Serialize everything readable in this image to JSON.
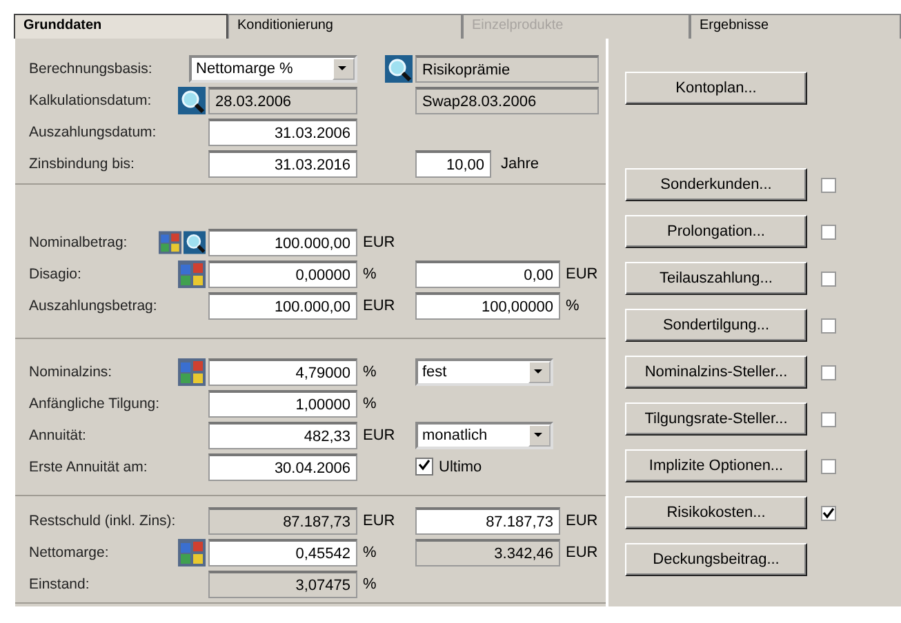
{
  "tabs": [
    {
      "label": "Grunddaten",
      "selected": true,
      "disabled": false
    },
    {
      "label": "Konditionierung",
      "selected": false,
      "disabled": false
    },
    {
      "label": "Einzelprodukte",
      "selected": false,
      "disabled": true
    },
    {
      "label": "Ergebnisse",
      "selected": false,
      "disabled": false
    }
  ],
  "sections": [
    {
      "rows": [
        {
          "label": "Berechnungsbasis:",
          "main": {
            "kind": "dropdown",
            "value": "Nettomarge %"
          },
          "side": {
            "kind": "readonly",
            "value": "Risikoprämie"
          }
        },
        {
          "label": "Kalkulationsdatum:",
          "main": {
            "kind": "readonly",
            "value": "28.03.2006"
          },
          "side": {
            "kind": "readonly",
            "value": "Swap28.03.2006"
          }
        },
        {
          "label": "Auszahlungsdatum:",
          "main": {
            "kind": "field",
            "value": "31.03.2006"
          }
        },
        {
          "label": "Zinsbindung bis:",
          "main": {
            "kind": "field",
            "value": "31.03.2016"
          },
          "side": {
            "kind": "field",
            "value": "10,00"
          },
          "side_unit": "Jahre"
        }
      ]
    },
    {
      "rows": [
        {
          "label": "Nominalbetrag:",
          "main": {
            "kind": "field",
            "value": "100.000,00"
          },
          "unit": "EUR"
        },
        {
          "label": "Disagio:",
          "main": {
            "kind": "field",
            "value": "0,00000"
          },
          "unit": "%",
          "side": {
            "kind": "field",
            "value": "0,00"
          },
          "side_unit": "EUR"
        },
        {
          "label": "Auszahlungsbetrag:",
          "main": {
            "kind": "field",
            "value": "100.000,00"
          },
          "unit": "EUR",
          "side": {
            "kind": "field",
            "value": "100,00000"
          },
          "side_unit": "%"
        }
      ]
    },
    {
      "rows": [
        {
          "label": "Nominalzins:",
          "main": {
            "kind": "field",
            "value": "4,79000"
          },
          "unit": "%",
          "side": {
            "kind": "dropdown",
            "value": "fest"
          }
        },
        {
          "label": "Anfängliche Tilgung:",
          "main": {
            "kind": "field",
            "value": "1,00000"
          },
          "unit": "%"
        },
        {
          "label": "Annuität:",
          "main": {
            "kind": "field",
            "value": "482,33"
          },
          "unit": "EUR",
          "side": {
            "kind": "dropdown",
            "value": "monatlich"
          }
        },
        {
          "label": "Erste Annuität am:",
          "main": {
            "kind": "field",
            "value": "30.04.2006"
          },
          "side": {
            "kind": "checkbox",
            "label": "Ultimo",
            "checked": true
          }
        }
      ]
    },
    {
      "rows": [
        {
          "label": "Restschuld (inkl. Zins):",
          "main": {
            "kind": "readonly",
            "value": "87.187,73"
          },
          "unit": "EUR",
          "side": {
            "kind": "field",
            "value": "87.187,73"
          },
          "side_unit": "EUR"
        },
        {
          "label": "Nettomarge:",
          "main": {
            "kind": "field",
            "value": "0,45542"
          },
          "unit": "%",
          "side": {
            "kind": "readonly",
            "value": "3.342,46"
          },
          "side_unit": "EUR"
        },
        {
          "label": "Einstand:",
          "main": {
            "kind": "readonly",
            "value": "3,07475"
          },
          "unit": "%"
        }
      ]
    }
  ],
  "side_buttons": [
    {
      "label": "Kontoplan..."
    },
    {
      "label": "Sonderkunden...",
      "checked": false
    },
    {
      "label": "Prolongation...",
      "checked": false
    },
    {
      "label": "Teilauszahlung...",
      "checked": false
    },
    {
      "label": "Sondertilgung...",
      "checked": false
    },
    {
      "label": "Nominalzins-Steller...",
      "checked": false
    },
    {
      "label": "Tilgungsrate-Steller...",
      "checked": false
    },
    {
      "label": "Implizite Optionen...",
      "checked": false
    },
    {
      "label": "Risikokosten...",
      "checked": true
    },
    {
      "label": "Deckungsbeitrag..."
    }
  ]
}
